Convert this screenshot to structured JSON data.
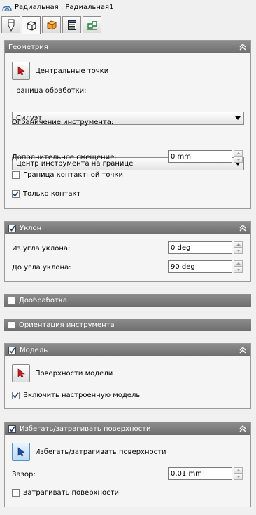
{
  "title": "Радиальная : Радиальная1",
  "tabs": [
    {
      "icon": "tool-icon",
      "active": false
    },
    {
      "icon": "cube-outline-icon",
      "active": true
    },
    {
      "icon": "cube-orange-icon",
      "active": false
    },
    {
      "icon": "sheet-list-icon",
      "active": false
    },
    {
      "icon": "linking-icon",
      "active": false
    }
  ],
  "geometry": {
    "title": "Геометрия",
    "center_points_label": "Центральные точки",
    "boundary_label": "Граница обработки:",
    "boundary_value": "Силуэт",
    "tool_limit_label": "Ограничение инструмента:",
    "tool_limit_value": "Центр инструмента на границе",
    "offset_label": "Дополнительное смещение:",
    "offset_value": "0 mm",
    "contact_boundary_label": "Граница контактной точки",
    "contact_boundary_checked": false,
    "contact_only_label": "Только контакт",
    "contact_only_checked": true
  },
  "slope": {
    "title": "Уклон",
    "enabled": true,
    "from_label": "Из угла уклона:",
    "from_value": "0 deg",
    "to_label": "До угла уклона:",
    "to_value": "90 deg"
  },
  "rest": {
    "title": "Дообработка",
    "enabled": false
  },
  "orientation": {
    "title": "Ориентация инструмента",
    "enabled": false
  },
  "model": {
    "title": "Модель",
    "enabled": true,
    "surfaces_label": "Поверхности модели",
    "include_label": "Включить настроенную модель",
    "include_checked": true
  },
  "avoid": {
    "title": "Избегать/затрагивать поверхности",
    "enabled": true,
    "surfaces_label": "Избегать/затрагивать поверхности",
    "gap_label": "Зазор:",
    "gap_value": "0.01 mm",
    "touch_label": "Затрагивать поверхности",
    "touch_checked": false
  },
  "colors": {
    "panel_header": "#7d7d7d",
    "selection_active": "#bcdcf6",
    "arrow_red": "#c81e1e"
  }
}
